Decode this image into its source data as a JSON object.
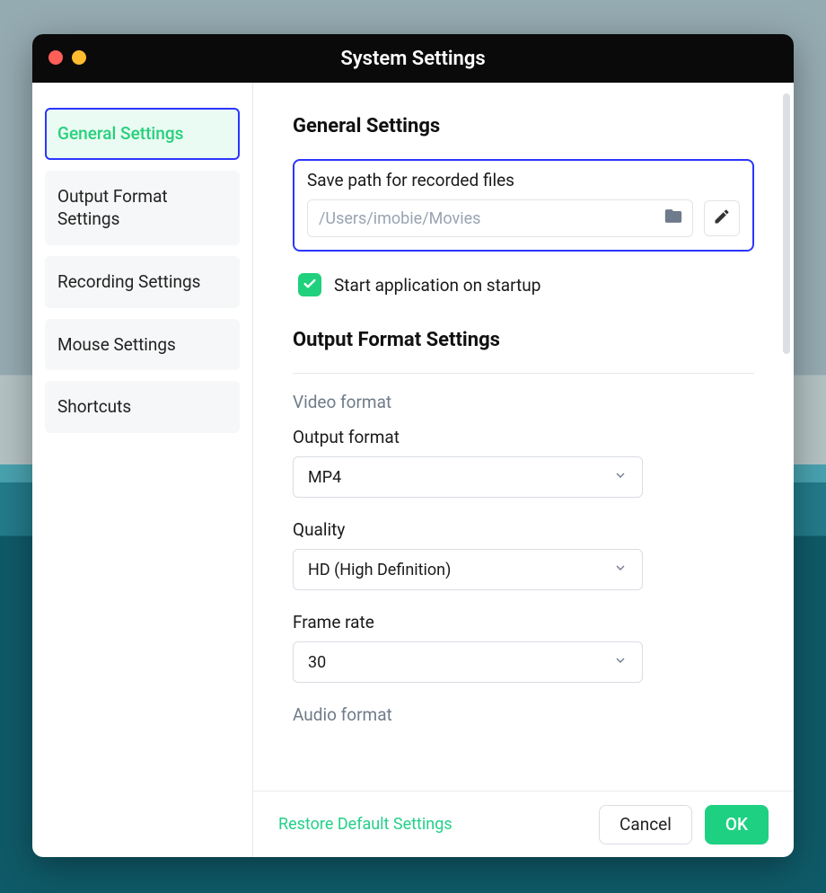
{
  "window": {
    "title": "System Settings"
  },
  "sidebar": {
    "items": [
      {
        "label": "General Settings",
        "active": true
      },
      {
        "label": "Output Format Settings",
        "active": false
      },
      {
        "label": "Recording Settings",
        "active": false
      },
      {
        "label": "Mouse Settings",
        "active": false
      },
      {
        "label": "Shortcuts",
        "active": false
      }
    ]
  },
  "general": {
    "heading": "General Settings",
    "save_path_label": "Save path for recorded files",
    "save_path_value": "/Users/imobie/Movies",
    "startup_checkbox_label": "Start application on startup",
    "startup_checked": true
  },
  "output_format": {
    "heading": "Output Format Settings",
    "video_format_subheading": "Video format",
    "output_format_label": "Output format",
    "output_format_value": "MP4",
    "quality_label": "Quality",
    "quality_value": "HD (High Definition)",
    "frame_rate_label": "Frame rate",
    "frame_rate_value": "30",
    "audio_format_subheading": "Audio format"
  },
  "footer": {
    "restore_label": "Restore Default Settings",
    "cancel_label": "Cancel",
    "ok_label": "OK"
  }
}
